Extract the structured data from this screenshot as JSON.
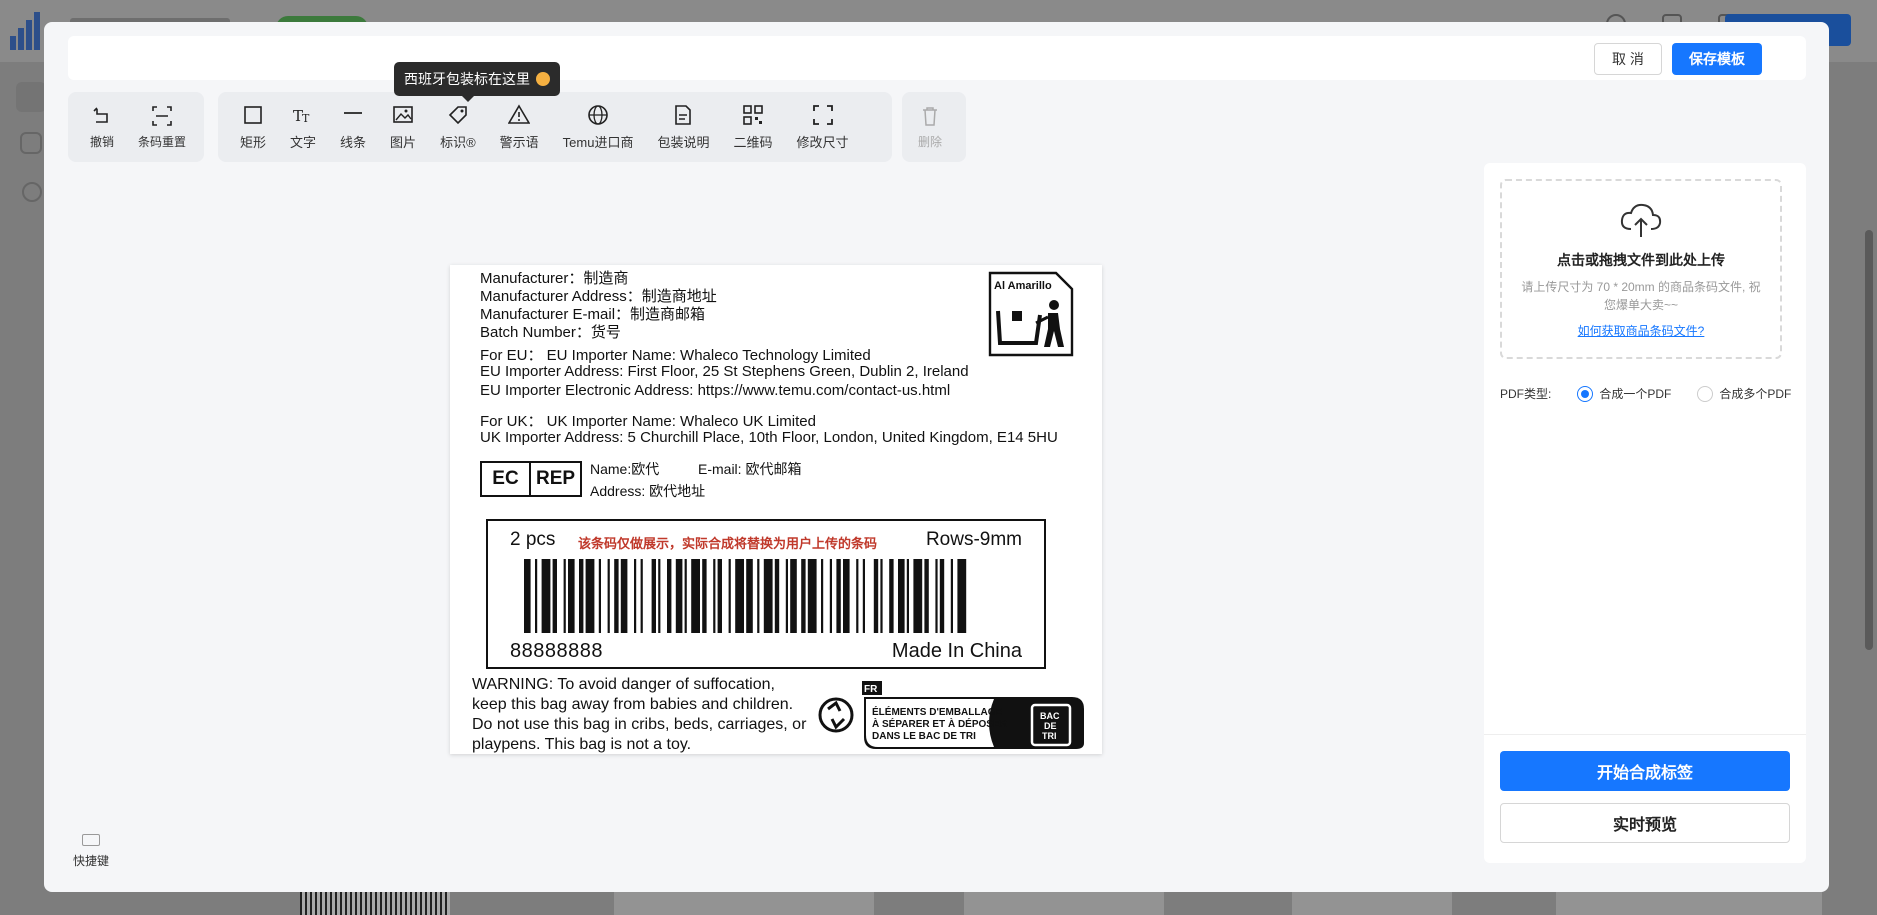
{
  "toolbar_left": [
    {
      "label": "撤销",
      "icon": "undo-icon"
    },
    {
      "label": "条码重置",
      "icon": "barcode-reset-icon"
    }
  ],
  "toolbar_main": [
    {
      "label": "矩形",
      "icon": "rectangle-icon"
    },
    {
      "label": "文字",
      "icon": "text-icon"
    },
    {
      "label": "线条",
      "icon": "line-icon"
    },
    {
      "label": "图片",
      "icon": "image-icon"
    },
    {
      "label": "标识®",
      "icon": "tag-icon"
    },
    {
      "label": "警示语",
      "icon": "warning-icon"
    },
    {
      "label": "Temu进口商",
      "icon": "globe-icon"
    },
    {
      "label": "包装说明",
      "icon": "document-icon"
    },
    {
      "label": "二维码",
      "icon": "qrcode-icon"
    },
    {
      "label": "修改尺寸",
      "icon": "resize-icon"
    }
  ],
  "toolbar_delete": {
    "label": "删除",
    "icon": "trash-icon"
  },
  "tooltip": "西班牙包装标在这里",
  "header": {
    "cancel": "取 消",
    "save": "保存模板"
  },
  "label": {
    "manufacturer": [
      "Manufacturer：制造商",
      "Manufacturer Address：制造商地址",
      "Manufacturer E-mail：制造商邮箱",
      "Batch Number：货号"
    ],
    "eu": [
      "For EU：  EU Importer Name: Whaleco Technology Limited",
      "EU Importer Address: First Floor, 25 St Stephens Green, Dublin 2, Ireland",
      "EU Importer Electronic Address: https://www.temu.com/contact-us.html"
    ],
    "uk": [
      "For UK：  UK Importer Name: Whaleco UK Limited",
      "UK Importer Address: 5 Churchill Place, 10th Floor, London, United  Kingdom, E14 5HU"
    ],
    "ec_rep": {
      "ec": "EC",
      "rep": "REP",
      "name": "Name:欧代",
      "email": "E-mail: 欧代邮箱",
      "address": "Address: 欧代地址"
    },
    "amarillo": "Al Amarillo",
    "barcode": {
      "qty": "2 pcs",
      "notice": "该条码仅做展示，实际合成将替换为用户上传的条码",
      "rows": "Rows-9mm",
      "number": "88888888",
      "origin": "Made In China"
    },
    "warning": "WARNING: To avoid danger of suffocation, keep this bag away from babies and children. Do not use this bag in cribs, beds, carriages, or playpens. This bag is not a toy.",
    "triman": {
      "country": "FR",
      "lines": [
        "ÉLÉMENTS D'EMBALLAGE",
        "À SÉPARER ET À DÉPOSER",
        "DANS LE BAC DE TRI"
      ],
      "bin": [
        "BAC",
        "DE",
        "TRI"
      ]
    }
  },
  "upload": {
    "title": "点击或拖拽文件到此处上传",
    "hint": "请上传尺寸为 70 * 20mm 的商品条码文件, 祝您爆单大卖~~",
    "link": "如何获取商品条码文件?"
  },
  "pdf": {
    "label": "PDF类型:",
    "options": [
      "合成一个PDF",
      "合成多个PDF"
    ],
    "selected": "合成一个PDF"
  },
  "actions": {
    "start": "开始合成标签",
    "preview": "实时预览"
  },
  "shortcut": "快捷键",
  "colors": {
    "primary": "#1677ff",
    "notice_red": "#c0392b"
  }
}
